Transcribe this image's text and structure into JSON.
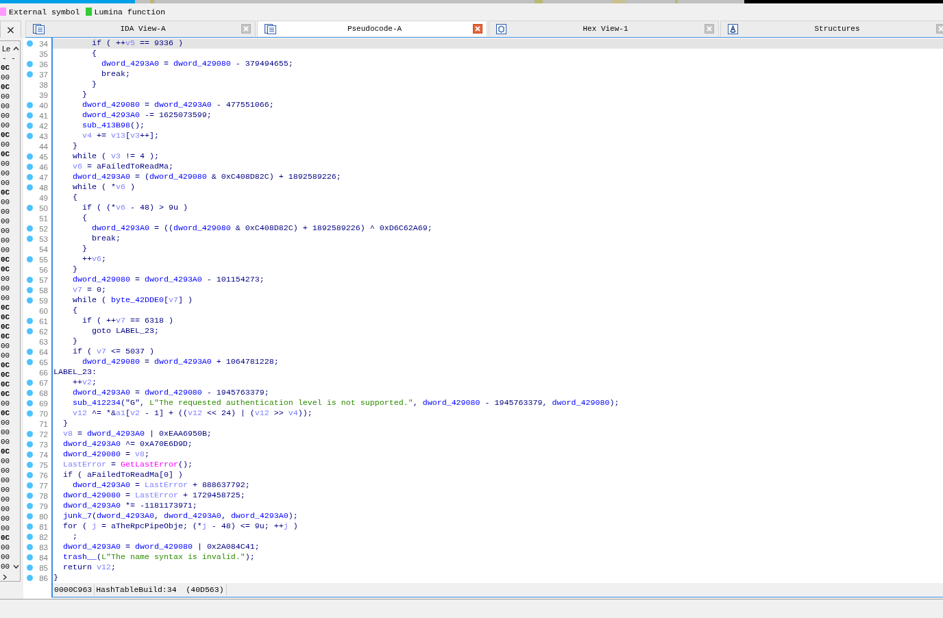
{
  "legend": [
    {
      "label": "External symbol",
      "color": "#ff99ff"
    },
    {
      "label": "Lumina function",
      "color": "#33cc33"
    }
  ],
  "panel_close": "×",
  "tabs": [
    {
      "title": "IDA View-A",
      "selected": false,
      "kind": "listing"
    },
    {
      "title": "Pseudocode-A",
      "selected": true,
      "kind": "listing"
    },
    {
      "title": "Hex View-1",
      "selected": false,
      "kind": "hex"
    },
    {
      "title": "Structures",
      "selected": false,
      "kind": "struct"
    }
  ],
  "side_panel": {
    "header": "Le",
    "header_rule": "- -",
    "rows": [
      {
        "text": "0C",
        "bold": true
      },
      {
        "text": "00",
        "bold": false
      },
      {
        "text": "0C",
        "bold": true
      },
      {
        "text": "00",
        "bold": false
      },
      {
        "text": "00",
        "bold": false
      },
      {
        "text": "00",
        "bold": false
      },
      {
        "text": "00",
        "bold": false
      },
      {
        "text": "0C",
        "bold": true
      },
      {
        "text": "00",
        "bold": false
      },
      {
        "text": "0C",
        "bold": true
      },
      {
        "text": "00",
        "bold": false
      },
      {
        "text": "00",
        "bold": false
      },
      {
        "text": "00",
        "bold": false
      },
      {
        "text": "0C",
        "bold": true
      },
      {
        "text": "00",
        "bold": false
      },
      {
        "text": "00",
        "bold": false
      },
      {
        "text": "00",
        "bold": false
      },
      {
        "text": "00",
        "bold": false
      },
      {
        "text": "00",
        "bold": false
      },
      {
        "text": "00",
        "bold": false
      },
      {
        "text": "0C",
        "bold": true
      },
      {
        "text": "0C",
        "bold": true
      },
      {
        "text": "00",
        "bold": false
      },
      {
        "text": "00",
        "bold": false
      },
      {
        "text": "00",
        "bold": false
      },
      {
        "text": "0C",
        "bold": true
      },
      {
        "text": "0C",
        "bold": true
      },
      {
        "text": "0C",
        "bold": true
      },
      {
        "text": "0C",
        "bold": true
      },
      {
        "text": "00",
        "bold": false
      },
      {
        "text": "00",
        "bold": false
      },
      {
        "text": "0C",
        "bold": true
      },
      {
        "text": "0C",
        "bold": true
      },
      {
        "text": "0C",
        "bold": true
      },
      {
        "text": "0C",
        "bold": true
      },
      {
        "text": "00",
        "bold": false
      },
      {
        "text": "0C",
        "bold": true
      },
      {
        "text": "00",
        "bold": false
      },
      {
        "text": "00",
        "bold": false
      },
      {
        "text": "00",
        "bold": false
      },
      {
        "text": "0C",
        "bold": true
      },
      {
        "text": "00",
        "bold": false
      },
      {
        "text": "00",
        "bold": false
      },
      {
        "text": "00",
        "bold": false
      },
      {
        "text": "00",
        "bold": false
      },
      {
        "text": "00",
        "bold": false
      },
      {
        "text": "00",
        "bold": false
      },
      {
        "text": "00",
        "bold": false
      },
      {
        "text": "00",
        "bold": false
      },
      {
        "text": "0C",
        "bold": true
      },
      {
        "text": "00",
        "bold": false
      },
      {
        "text": "00",
        "bold": false
      },
      {
        "text": "00",
        "bold": false
      }
    ]
  },
  "code": {
    "lines": [
      {
        "n": "34",
        "dot": true,
        "selected": true,
        "tokens": [
          {
            "text": "        if ( ++",
            "kind": "plain"
          },
          {
            "text": "v5",
            "kind": "local"
          },
          {
            "text": " == 9336 )",
            "kind": "plain"
          }
        ]
      },
      {
        "n": "35",
        "dot": false,
        "selected": false,
        "tokens": [
          {
            "text": "        {",
            "kind": "plain"
          }
        ]
      },
      {
        "n": "36",
        "dot": true,
        "selected": false,
        "tokens": [
          {
            "text": "          dword_4293A0",
            "kind": "global"
          },
          {
            "text": " = ",
            "kind": "plain"
          },
          {
            "text": "dword_429080",
            "kind": "global"
          },
          {
            "text": " - 379494655;",
            "kind": "plain"
          }
        ]
      },
      {
        "n": "37",
        "dot": true,
        "selected": false,
        "tokens": [
          {
            "text": "          break;",
            "kind": "plain"
          }
        ]
      },
      {
        "n": "38",
        "dot": false,
        "selected": false,
        "tokens": [
          {
            "text": "        }",
            "kind": "plain"
          }
        ]
      },
      {
        "n": "39",
        "dot": false,
        "selected": false,
        "tokens": [
          {
            "text": "      }",
            "kind": "plain"
          }
        ]
      },
      {
        "n": "40",
        "dot": true,
        "selected": false,
        "tokens": [
          {
            "text": "      dword_429080",
            "kind": "global"
          },
          {
            "text": " = ",
            "kind": "plain"
          },
          {
            "text": "dword_4293A0",
            "kind": "global"
          },
          {
            "text": " - 477551066;",
            "kind": "plain"
          }
        ]
      },
      {
        "n": "41",
        "dot": true,
        "selected": false,
        "tokens": [
          {
            "text": "      dword_4293A0",
            "kind": "global"
          },
          {
            "text": " -= 1625073599;",
            "kind": "plain"
          }
        ]
      },
      {
        "n": "42",
        "dot": true,
        "selected": false,
        "tokens": [
          {
            "text": "      sub_413B98",
            "kind": "global"
          },
          {
            "text": "();",
            "kind": "plain"
          }
        ]
      },
      {
        "n": "43",
        "dot": true,
        "selected": false,
        "tokens": [
          {
            "text": "      v4",
            "kind": "local"
          },
          {
            "text": " += ",
            "kind": "plain"
          },
          {
            "text": "v13",
            "kind": "local"
          },
          {
            "text": "[",
            "kind": "plain"
          },
          {
            "text": "v3",
            "kind": "local"
          },
          {
            "text": "++];",
            "kind": "plain"
          }
        ]
      },
      {
        "n": "44",
        "dot": false,
        "selected": false,
        "tokens": [
          {
            "text": "    }",
            "kind": "plain"
          }
        ]
      },
      {
        "n": "45",
        "dot": true,
        "selected": false,
        "tokens": [
          {
            "text": "    while ( ",
            "kind": "plain"
          },
          {
            "text": "v3",
            "kind": "local"
          },
          {
            "text": " != 4 );",
            "kind": "plain"
          }
        ]
      },
      {
        "n": "46",
        "dot": true,
        "selected": false,
        "tokens": [
          {
            "text": "    v6",
            "kind": "local"
          },
          {
            "text": " = aFailedToReadMa;",
            "kind": "plain"
          }
        ]
      },
      {
        "n": "47",
        "dot": true,
        "selected": false,
        "tokens": [
          {
            "text": "    dword_4293A0",
            "kind": "global"
          },
          {
            "text": " = (",
            "kind": "plain"
          },
          {
            "text": "dword_429080",
            "kind": "global"
          },
          {
            "text": " & 0xC408D82C) + 1892589226;",
            "kind": "plain"
          }
        ]
      },
      {
        "n": "48",
        "dot": true,
        "selected": false,
        "tokens": [
          {
            "text": "    while ( *",
            "kind": "plain"
          },
          {
            "text": "v6",
            "kind": "local"
          },
          {
            "text": " )",
            "kind": "plain"
          }
        ]
      },
      {
        "n": "49",
        "dot": false,
        "selected": false,
        "tokens": [
          {
            "text": "    {",
            "kind": "plain"
          }
        ]
      },
      {
        "n": "50",
        "dot": true,
        "selected": false,
        "tokens": [
          {
            "text": "      if ( (*",
            "kind": "plain"
          },
          {
            "text": "v6",
            "kind": "local"
          },
          {
            "text": " - 48) > 9u )",
            "kind": "plain"
          }
        ]
      },
      {
        "n": "51",
        "dot": false,
        "selected": false,
        "tokens": [
          {
            "text": "      {",
            "kind": "plain"
          }
        ]
      },
      {
        "n": "52",
        "dot": true,
        "selected": false,
        "tokens": [
          {
            "text": "        dword_4293A0",
            "kind": "global"
          },
          {
            "text": " = ((",
            "kind": "plain"
          },
          {
            "text": "dword_429080",
            "kind": "global"
          },
          {
            "text": " & 0xC408D82C) + 1892589226) ^ 0xD6C62A69;",
            "kind": "plain"
          }
        ]
      },
      {
        "n": "53",
        "dot": true,
        "selected": false,
        "tokens": [
          {
            "text": "        break;",
            "kind": "plain"
          }
        ]
      },
      {
        "n": "54",
        "dot": false,
        "selected": false,
        "tokens": [
          {
            "text": "      }",
            "kind": "plain"
          }
        ]
      },
      {
        "n": "55",
        "dot": true,
        "selected": false,
        "tokens": [
          {
            "text": "      ++",
            "kind": "plain"
          },
          {
            "text": "v6",
            "kind": "local"
          },
          {
            "text": ";",
            "kind": "plain"
          }
        ]
      },
      {
        "n": "56",
        "dot": false,
        "selected": false,
        "tokens": [
          {
            "text": "    }",
            "kind": "plain"
          }
        ]
      },
      {
        "n": "57",
        "dot": true,
        "selected": false,
        "tokens": [
          {
            "text": "    dword_429080",
            "kind": "global"
          },
          {
            "text": " = ",
            "kind": "plain"
          },
          {
            "text": "dword_4293A0",
            "kind": "global"
          },
          {
            "text": " - 101154273;",
            "kind": "plain"
          }
        ]
      },
      {
        "n": "58",
        "dot": true,
        "selected": false,
        "tokens": [
          {
            "text": "    v7",
            "kind": "local"
          },
          {
            "text": " = 0;",
            "kind": "plain"
          }
        ]
      },
      {
        "n": "59",
        "dot": true,
        "selected": false,
        "tokens": [
          {
            "text": "    while ( ",
            "kind": "plain"
          },
          {
            "text": "byte_42DDE0",
            "kind": "global"
          },
          {
            "text": "[",
            "kind": "plain"
          },
          {
            "text": "v7",
            "kind": "local"
          },
          {
            "text": "] )",
            "kind": "plain"
          }
        ]
      },
      {
        "n": "60",
        "dot": false,
        "selected": false,
        "tokens": [
          {
            "text": "    {",
            "kind": "plain"
          }
        ]
      },
      {
        "n": "61",
        "dot": true,
        "selected": false,
        "tokens": [
          {
            "text": "      if ( ++",
            "kind": "plain"
          },
          {
            "text": "v7",
            "kind": "local"
          },
          {
            "text": " == 6318 )",
            "kind": "plain"
          }
        ]
      },
      {
        "n": "62",
        "dot": true,
        "selected": false,
        "tokens": [
          {
            "text": "        goto LABEL_23;",
            "kind": "plain"
          }
        ]
      },
      {
        "n": "63",
        "dot": false,
        "selected": false,
        "tokens": [
          {
            "text": "    }",
            "kind": "plain"
          }
        ]
      },
      {
        "n": "64",
        "dot": true,
        "selected": false,
        "tokens": [
          {
            "text": "    if ( ",
            "kind": "plain"
          },
          {
            "text": "v7",
            "kind": "local"
          },
          {
            "text": " <= 5037 )",
            "kind": "plain"
          }
        ]
      },
      {
        "n": "65",
        "dot": true,
        "selected": false,
        "tokens": [
          {
            "text": "      dword_429080",
            "kind": "global"
          },
          {
            "text": " = ",
            "kind": "plain"
          },
          {
            "text": "dword_4293A0",
            "kind": "global"
          },
          {
            "text": " + 1064781228;",
            "kind": "plain"
          }
        ]
      },
      {
        "n": "66",
        "dot": false,
        "selected": false,
        "tokens": [
          {
            "text": "LABEL_23:",
            "kind": "plain"
          }
        ]
      },
      {
        "n": "67",
        "dot": true,
        "selected": false,
        "tokens": [
          {
            "text": "    ++",
            "kind": "plain"
          },
          {
            "text": "v2",
            "kind": "local"
          },
          {
            "text": ";",
            "kind": "plain"
          }
        ]
      },
      {
        "n": "68",
        "dot": true,
        "selected": false,
        "tokens": [
          {
            "text": "    dword_4293A0",
            "kind": "global"
          },
          {
            "text": " = ",
            "kind": "plain"
          },
          {
            "text": "dword_429080",
            "kind": "global"
          },
          {
            "text": " - 1945763379;",
            "kind": "plain"
          }
        ]
      },
      {
        "n": "69",
        "dot": true,
        "selected": false,
        "tokens": [
          {
            "text": "    sub_412234",
            "kind": "global"
          },
          {
            "text": "(\"G\", ",
            "kind": "plain"
          },
          {
            "text": "L\"The requested authentication level is not supported.\"",
            "kind": "string"
          },
          {
            "text": ", ",
            "kind": "plain"
          },
          {
            "text": "dword_429080",
            "kind": "global"
          },
          {
            "text": " - 1945763379, ",
            "kind": "plain"
          },
          {
            "text": "dword_429080",
            "kind": "global"
          },
          {
            "text": ");",
            "kind": "plain"
          }
        ]
      },
      {
        "n": "70",
        "dot": true,
        "selected": false,
        "tokens": [
          {
            "text": "    v12",
            "kind": "local"
          },
          {
            "text": " ^= *&",
            "kind": "plain"
          },
          {
            "text": "a1",
            "kind": "local"
          },
          {
            "text": "[",
            "kind": "plain"
          },
          {
            "text": "v2",
            "kind": "local"
          },
          {
            "text": " - 1] + ((",
            "kind": "plain"
          },
          {
            "text": "v12",
            "kind": "local"
          },
          {
            "text": " << 24) | (",
            "kind": "plain"
          },
          {
            "text": "v12",
            "kind": "local"
          },
          {
            "text": " >> ",
            "kind": "plain"
          },
          {
            "text": "v4",
            "kind": "local"
          },
          {
            "text": "));",
            "kind": "plain"
          }
        ]
      },
      {
        "n": "71",
        "dot": false,
        "selected": false,
        "tokens": [
          {
            "text": "  }",
            "kind": "plain"
          }
        ]
      },
      {
        "n": "72",
        "dot": true,
        "selected": false,
        "tokens": [
          {
            "text": "  v8",
            "kind": "local"
          },
          {
            "text": " = ",
            "kind": "plain"
          },
          {
            "text": "dword_4293A0",
            "kind": "global"
          },
          {
            "text": " | 0xEAA6950B;",
            "kind": "plain"
          }
        ]
      },
      {
        "n": "73",
        "dot": true,
        "selected": false,
        "tokens": [
          {
            "text": "  dword_4293A0",
            "kind": "global"
          },
          {
            "text": " ^= 0xA70E6D9D;",
            "kind": "plain"
          }
        ]
      },
      {
        "n": "74",
        "dot": true,
        "selected": false,
        "tokens": [
          {
            "text": "  dword_429080",
            "kind": "global"
          },
          {
            "text": " = ",
            "kind": "plain"
          },
          {
            "text": "v8",
            "kind": "local"
          },
          {
            "text": ";",
            "kind": "plain"
          }
        ]
      },
      {
        "n": "75",
        "dot": true,
        "selected": false,
        "tokens": [
          {
            "text": "  LastError",
            "kind": "local"
          },
          {
            "text": " = ",
            "kind": "plain"
          },
          {
            "text": "GetLastError",
            "kind": "import"
          },
          {
            "text": "();",
            "kind": "plain"
          }
        ]
      },
      {
        "n": "76",
        "dot": true,
        "selected": false,
        "tokens": [
          {
            "text": "  if ( aFailedToReadMa[0] )",
            "kind": "plain"
          }
        ]
      },
      {
        "n": "77",
        "dot": true,
        "selected": false,
        "tokens": [
          {
            "text": "    dword_4293A0",
            "kind": "global"
          },
          {
            "text": " = ",
            "kind": "plain"
          },
          {
            "text": "LastError",
            "kind": "local"
          },
          {
            "text": " + 888637792;",
            "kind": "plain"
          }
        ]
      },
      {
        "n": "78",
        "dot": true,
        "selected": false,
        "tokens": [
          {
            "text": "  dword_429080",
            "kind": "global"
          },
          {
            "text": " = ",
            "kind": "plain"
          },
          {
            "text": "LastError",
            "kind": "local"
          },
          {
            "text": " + 1729458725;",
            "kind": "plain"
          }
        ]
      },
      {
        "n": "79",
        "dot": true,
        "selected": false,
        "tokens": [
          {
            "text": "  dword_4293A0",
            "kind": "global"
          },
          {
            "text": " *= -1181173971;",
            "kind": "plain"
          }
        ]
      },
      {
        "n": "80",
        "dot": true,
        "selected": false,
        "tokens": [
          {
            "text": "  junk_7",
            "kind": "global"
          },
          {
            "text": "(",
            "kind": "plain"
          },
          {
            "text": "dword_4293A0",
            "kind": "global"
          },
          {
            "text": ", ",
            "kind": "plain"
          },
          {
            "text": "dword_4293A0",
            "kind": "global"
          },
          {
            "text": ", ",
            "kind": "plain"
          },
          {
            "text": "dword_4293A0",
            "kind": "global"
          },
          {
            "text": ");",
            "kind": "plain"
          }
        ]
      },
      {
        "n": "81",
        "dot": true,
        "selected": false,
        "tokens": [
          {
            "text": "  for ( ",
            "kind": "plain"
          },
          {
            "text": "j",
            "kind": "local"
          },
          {
            "text": " = aTheRpcPipeObje; (*",
            "kind": "plain"
          },
          {
            "text": "j",
            "kind": "local"
          },
          {
            "text": " - 48) <= 9u; ++",
            "kind": "plain"
          },
          {
            "text": "j",
            "kind": "local"
          },
          {
            "text": " )",
            "kind": "plain"
          }
        ]
      },
      {
        "n": "82",
        "dot": true,
        "selected": false,
        "tokens": [
          {
            "text": "    ;",
            "kind": "plain"
          }
        ]
      },
      {
        "n": "83",
        "dot": true,
        "selected": false,
        "tokens": [
          {
            "text": "  dword_4293A0",
            "kind": "global"
          },
          {
            "text": " = ",
            "kind": "plain"
          },
          {
            "text": "dword_429080",
            "kind": "global"
          },
          {
            "text": " | 0x2A084C41;",
            "kind": "plain"
          }
        ]
      },
      {
        "n": "84",
        "dot": true,
        "selected": false,
        "tokens": [
          {
            "text": "  trash__",
            "kind": "global"
          },
          {
            "text": "(",
            "kind": "plain"
          },
          {
            "text": "L\"The name syntax is invalid.\"",
            "kind": "string"
          },
          {
            "text": ");",
            "kind": "plain"
          }
        ]
      },
      {
        "n": "85",
        "dot": true,
        "selected": false,
        "tokens": [
          {
            "text": "  return ",
            "kind": "plain"
          },
          {
            "text": "v12",
            "kind": "local"
          },
          {
            "text": ";",
            "kind": "plain"
          }
        ]
      },
      {
        "n": "86",
        "dot": true,
        "selected": false,
        "tokens": [
          {
            "text": "}",
            "kind": "plain"
          }
        ]
      }
    ]
  },
  "status_bar": {
    "offset": "0000C963",
    "location": "HashTableBuild:34  (40D563)"
  }
}
